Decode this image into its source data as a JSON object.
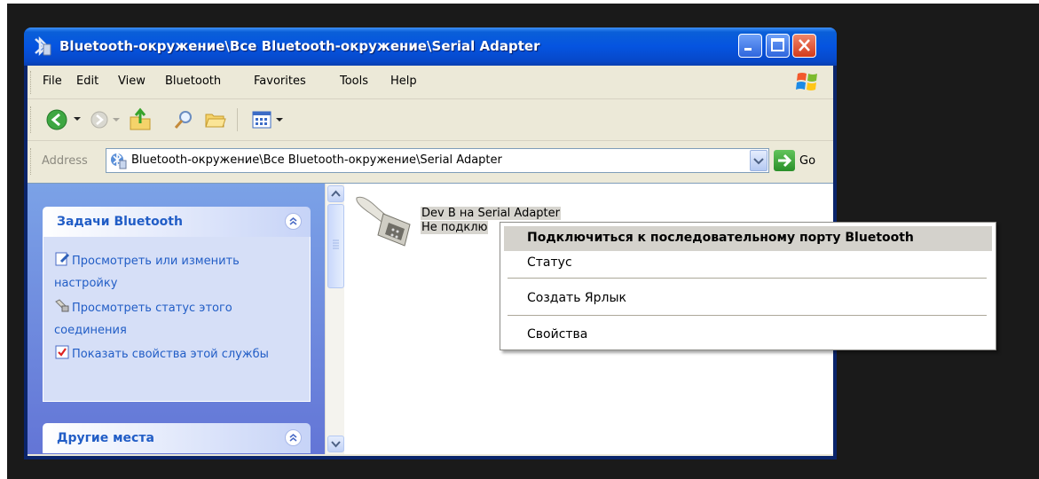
{
  "window": {
    "title": "Bluetooth-окружение\\Все Bluetooth-окружение\\Serial Adapter"
  },
  "menubar": {
    "items": [
      "File",
      "Edit",
      "View",
      "Bluetooth",
      "Favorites",
      "Tools",
      "Help"
    ]
  },
  "addressbar": {
    "label": "Address",
    "value": "Bluetooth-окружение\\Все Bluetooth-окружение\\Serial Adapter",
    "go_label": "Go"
  },
  "taskpane": {
    "bluetooth_tasks": {
      "title": "Задачи Bluetooth",
      "links": [
        "Просмотреть или изменить настройку",
        "Просмотреть статус этого соединения",
        "Показать свойства этой службы"
      ]
    },
    "other_places": {
      "title": "Другие места"
    }
  },
  "file": {
    "name": "Dev B на Serial Adapter",
    "status": "Не подклю"
  },
  "context_menu": {
    "items": [
      "Подключиться к последовательному порту Bluetooth",
      "Статус",
      "Создать Ярлык",
      "Свойства"
    ]
  },
  "icons": {
    "title": "bluetooth-icon",
    "back": "back-arrow-icon",
    "forward": "forward-arrow-icon",
    "up": "folder-up-icon",
    "search": "search-icon",
    "folders": "folders-icon",
    "views": "views-icon",
    "go": "go-arrow-icon",
    "file": "serial-port-icon"
  },
  "colors": {
    "titlebar": "#0554e0",
    "taskpane": "#6f8fdf",
    "link": "#215dc6",
    "background": "#1a1a1a"
  }
}
